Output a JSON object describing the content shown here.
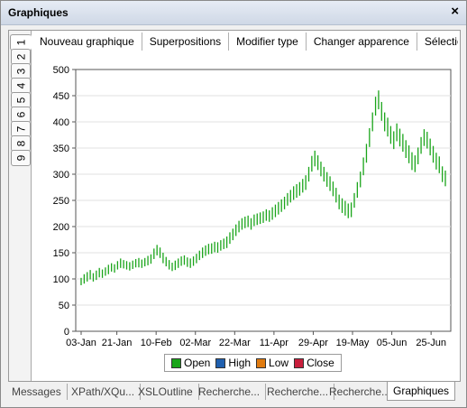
{
  "window": {
    "title": "Graphiques",
    "close_glyph": "×"
  },
  "vertical_tabs": [
    "1",
    "2",
    "3",
    "4",
    "5",
    "6",
    "7",
    "8",
    "9"
  ],
  "active_vertical_tab": "1",
  "toolbar_tabs": [
    "Nouveau graphique",
    "Superpositions",
    "Modifier type",
    "Changer apparence",
    "Sélectio"
  ],
  "bottom_tabs": [
    "Messages",
    "XPath/XQu...",
    "XSLOutline",
    "Recherche...",
    "Recherche...",
    "Recherche...",
    "Graphiques"
  ],
  "active_bottom_tab": "Graphiques",
  "chart_data": {
    "type": "candlestick",
    "title": "",
    "xlabel": "",
    "ylabel": "",
    "ylim": [
      0,
      500
    ],
    "yticks": [
      0,
      50,
      100,
      150,
      200,
      250,
      300,
      350,
      400,
      450,
      500
    ],
    "xticks": [
      "03-Jan",
      "21-Jan",
      "10-Feb",
      "02-Mar",
      "22-Mar",
      "11-Apr",
      "29-Apr",
      "19-May",
      "05-Jun",
      "25-Jun"
    ],
    "grid": true,
    "legend": "bottom-center",
    "series_names": [
      "Open",
      "High",
      "Low",
      "Close"
    ],
    "colors": {
      "Open": "#1aa51a",
      "High": "#1f5fae",
      "Low": "#e07b10",
      "Close": "#c81e3c"
    },
    "close": [
      95,
      100,
      104,
      108,
      103,
      107,
      112,
      110,
      114,
      118,
      122,
      120,
      126,
      130,
      128,
      126,
      124,
      127,
      130,
      131,
      129,
      132,
      135,
      138,
      148,
      155,
      150,
      140,
      133,
      127,
      123,
      126,
      130,
      134,
      136,
      132,
      130,
      134,
      139,
      145,
      150,
      154,
      157,
      158,
      161,
      160,
      164,
      167,
      170,
      178,
      185,
      193,
      200,
      205,
      208,
      210,
      205,
      212,
      214,
      216,
      218,
      222,
      220,
      225,
      230,
      235,
      240,
      245,
      252,
      258,
      264,
      268,
      272,
      278,
      284,
      300,
      320,
      330,
      322,
      310,
      300,
      290,
      282,
      272,
      260,
      247,
      240,
      235,
      230,
      232,
      250,
      270,
      290,
      315,
      340,
      370,
      400,
      430,
      442,
      420,
      400,
      390,
      375,
      365,
      380,
      370,
      360,
      348,
      338,
      325,
      320,
      335,
      355,
      370,
      365,
      352,
      338,
      325,
      318,
      300,
      292
    ],
    "spread": [
      14,
      18,
      18,
      18,
      16,
      18,
      18,
      16,
      16,
      18,
      16,
      16,
      16,
      18,
      16,
      16,
      16,
      16,
      16,
      18,
      16,
      16,
      18,
      18,
      20,
      20,
      20,
      20,
      18,
      18,
      16,
      18,
      18,
      18,
      18,
      18,
      18,
      18,
      18,
      18,
      20,
      20,
      20,
      20,
      20,
      20,
      20,
      20,
      22,
      22,
      22,
      22,
      22,
      22,
      22,
      22,
      22,
      22,
      22,
      22,
      22,
      22,
      22,
      24,
      24,
      24,
      24,
      24,
      24,
      24,
      26,
      26,
      26,
      26,
      28,
      28,
      30,
      30,
      28,
      28,
      28,
      28,
      28,
      28,
      28,
      28,
      28,
      28,
      28,
      28,
      28,
      30,
      30,
      34,
      36,
      36,
      36,
      36,
      36,
      36,
      36,
      36,
      34,
      34,
      34,
      34,
      34,
      34,
      34,
      34,
      32,
      32,
      32,
      32,
      32,
      32,
      32,
      32,
      32,
      30,
      30
    ]
  }
}
